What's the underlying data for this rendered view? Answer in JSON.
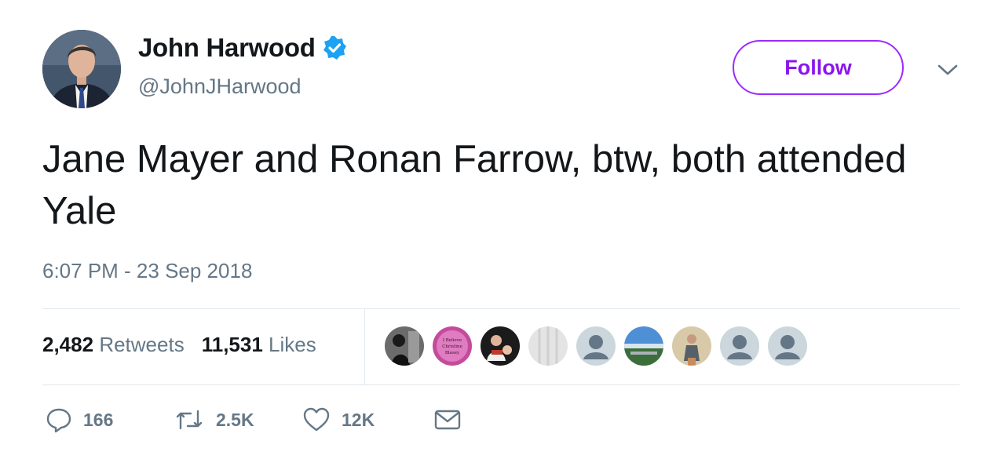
{
  "author": {
    "name": "John Harwood",
    "handle": "@JohnJHarwood",
    "verified": true,
    "avatar_icon": "profile-photo"
  },
  "follow_label": "Follow",
  "tweet": {
    "text": "Jane Mayer and Ronan Farrow, btw, both attended Yale",
    "timestamp": "6:07 PM - 23 Sep 2018"
  },
  "stats": {
    "retweets_count": "2,482",
    "retweets_label": "Retweets",
    "likes_count": "11,531",
    "likes_label": "Likes"
  },
  "liked_by_avatars": [
    {
      "icon": "photo-avatar"
    },
    {
      "icon": "button-avatar",
      "text": "I Believe Christine Blasey"
    },
    {
      "icon": "photo-avatar"
    },
    {
      "icon": "pattern-avatar"
    },
    {
      "icon": "default-avatar"
    },
    {
      "icon": "landscape-avatar"
    },
    {
      "icon": "photo-avatar"
    },
    {
      "icon": "default-avatar"
    },
    {
      "icon": "default-avatar"
    }
  ],
  "actions": {
    "replies": "166",
    "retweets": "2.5K",
    "likes": "12K"
  },
  "colors": {
    "verified": "#1da1f2",
    "follow_accent": "#8a15f0",
    "secondary_text": "#657786",
    "divider": "#e1e8ed"
  }
}
